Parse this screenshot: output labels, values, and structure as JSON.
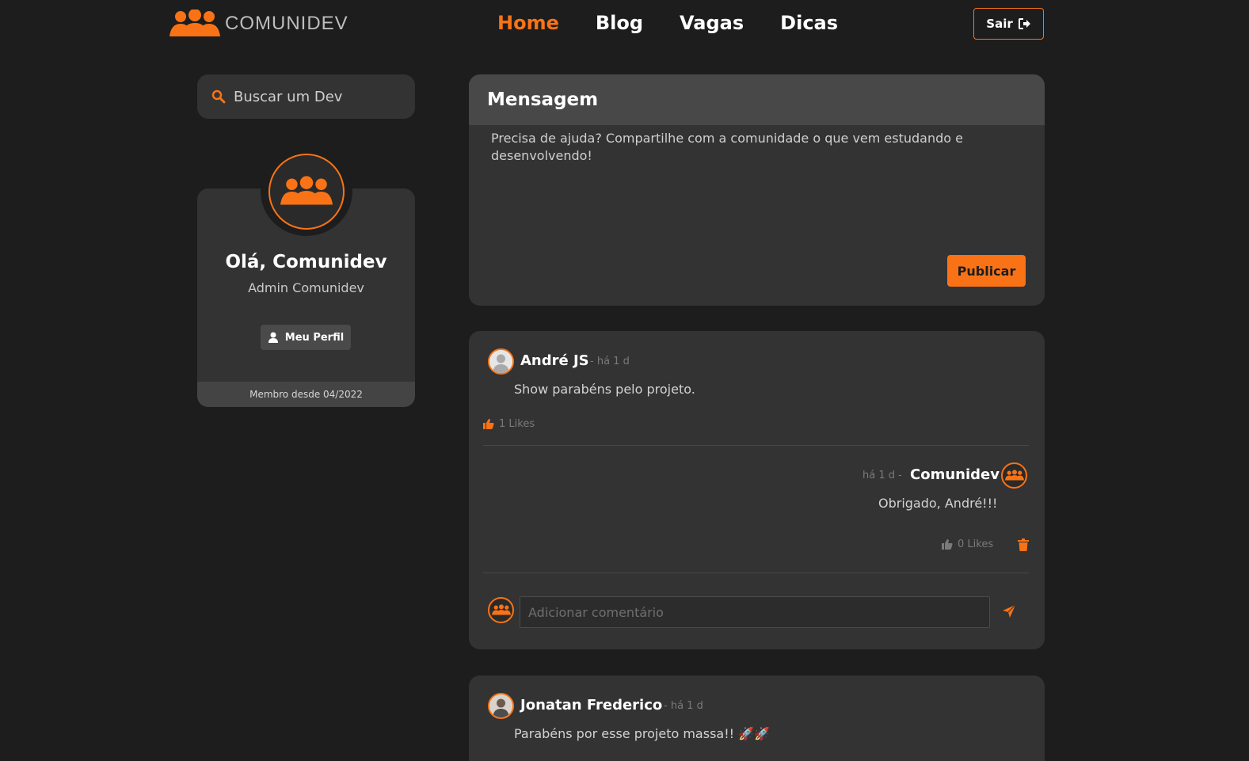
{
  "header": {
    "logo_text": "COMUNIDEV",
    "nav": [
      {
        "label": "Home",
        "active": true
      },
      {
        "label": "Blog",
        "active": false
      },
      {
        "label": "Vagas",
        "active": false
      },
      {
        "label": "Dicas",
        "active": false
      }
    ],
    "logout_label": "Sair"
  },
  "sidebar": {
    "search_placeholder": "Buscar um Dev",
    "profile": {
      "greeting": "Olá, Comunidev",
      "role": "Admin Comunidev",
      "profile_button": "Meu Perfil",
      "member_since": "Membro desde 04/2022"
    }
  },
  "composer": {
    "title": "Mensagem",
    "placeholder": "Precisa de ajuda? Compartilhe com a comunidade o que vem estudando e desenvolvendo!",
    "publish_label": "Publicar"
  },
  "posts": [
    {
      "author": "André JS",
      "time": "- há 1 d",
      "text": "Show parabéns pelo projeto.",
      "likes": "1 Likes",
      "reply": {
        "author": "Comunidev",
        "time": "há 1 d -",
        "text": "Obrigado, André!!!",
        "likes": "0 Likes"
      },
      "comment_placeholder": "Adicionar comentário"
    },
    {
      "author": "Jonatan Frederico",
      "time": "- há 1 d",
      "text": "Parabéns por esse projeto massa!! 🚀🚀"
    }
  ],
  "colors": {
    "accent": "#f97316",
    "background": "#1d1d1d",
    "card": "#333333"
  },
  "icons": [
    "group-icon",
    "logout-icon",
    "search-icon",
    "user-icon",
    "thumbs-up-icon",
    "trash-icon",
    "send-icon"
  ]
}
